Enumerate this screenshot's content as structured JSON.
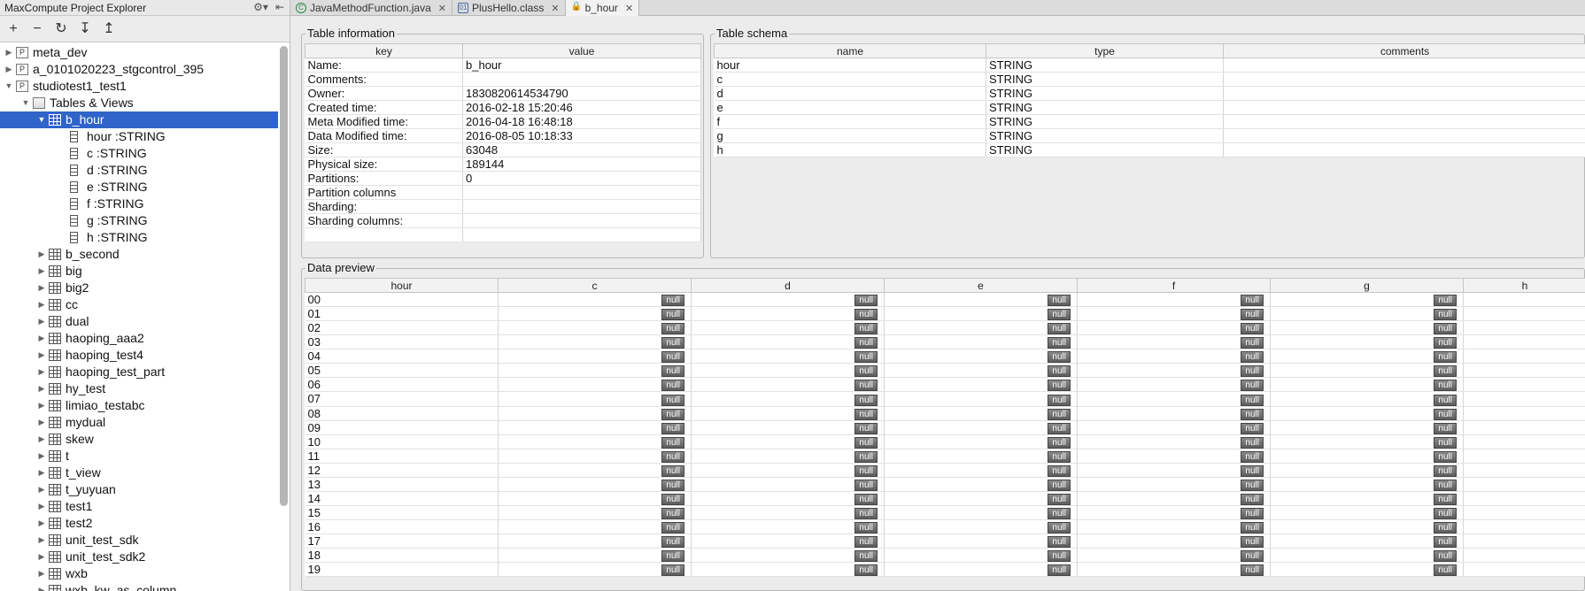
{
  "explorer": {
    "title": "MaxCompute Project Explorer",
    "toolbar": [
      "+",
      "−",
      "↻",
      "↧",
      "↥"
    ],
    "projects": [
      {
        "label": "meta_dev"
      },
      {
        "label": "a_0101020223_stgcontrol_395"
      },
      {
        "label": "studiotest1_test1"
      }
    ],
    "tables_and_views_label": "Tables & Views",
    "selected_table": "b_hour",
    "columns": [
      "hour :STRING",
      "c :STRING",
      "d :STRING",
      "e :STRING",
      "f :STRING",
      "g :STRING",
      "h :STRING"
    ],
    "other_tables": [
      "b_second",
      "big",
      "big2",
      "cc",
      "dual",
      "haoping_aaa2",
      "haoping_test4",
      "haoping_test_part",
      "hy_test",
      "limiao_testabc",
      "mydual",
      "skew",
      "t",
      "t_view",
      "t_yuyuan",
      "test1",
      "test2",
      "unit_test_sdk",
      "unit_test_sdk2",
      "wxb",
      "wxb_kw_as_column"
    ]
  },
  "tabs": [
    {
      "label": "JavaMethodFunction.java",
      "icon": "c-class-icon",
      "active": false
    },
    {
      "label": "PlusHello.class",
      "icon": "class-file-icon",
      "active": false
    },
    {
      "label": "b_hour",
      "icon": "lock-icon",
      "active": true
    }
  ],
  "table_info": {
    "title": "Table information",
    "headers": [
      "key",
      "value"
    ],
    "rows": [
      [
        "Name:",
        "b_hour"
      ],
      [
        "Comments:",
        ""
      ],
      [
        "Owner:",
        "1830820614534790"
      ],
      [
        "Created time:",
        "2016-02-18 15:20:46"
      ],
      [
        "Meta Modified time:",
        "2016-04-18 16:48:18"
      ],
      [
        "Data Modified time:",
        "2016-08-05 10:18:33"
      ],
      [
        "Size:",
        "63048"
      ],
      [
        "Physical size:",
        "189144"
      ],
      [
        "Partitions:",
        "0"
      ],
      [
        "Partition columns",
        ""
      ],
      [
        "Sharding:",
        ""
      ],
      [
        "Sharding columns:",
        ""
      ]
    ]
  },
  "table_schema": {
    "title": "Table schema",
    "headers": [
      "name",
      "type",
      "comments"
    ],
    "rows": [
      [
        "hour",
        "STRING",
        ""
      ],
      [
        "c",
        "STRING",
        ""
      ],
      [
        "d",
        "STRING",
        ""
      ],
      [
        "e",
        "STRING",
        ""
      ],
      [
        "f",
        "STRING",
        ""
      ],
      [
        "g",
        "STRING",
        ""
      ],
      [
        "h",
        "STRING",
        ""
      ]
    ]
  },
  "data_preview": {
    "title": "Data preview",
    "headers": [
      "hour",
      "c",
      "d",
      "e",
      "f",
      "g",
      "h"
    ],
    "null_label": "null",
    "hours": [
      "00",
      "01",
      "02",
      "03",
      "04",
      "05",
      "06",
      "07",
      "08",
      "09",
      "10",
      "11",
      "12",
      "13",
      "14",
      "15",
      "16",
      "17",
      "18",
      "19"
    ]
  }
}
